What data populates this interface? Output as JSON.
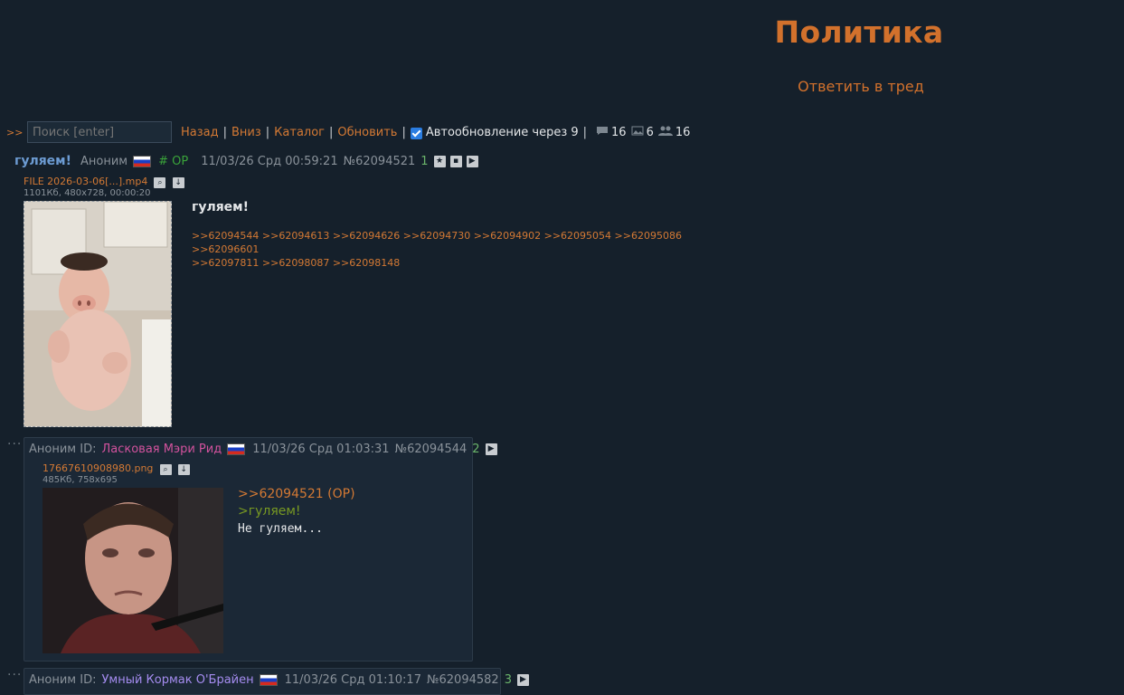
{
  "board": {
    "title": "Политика",
    "reply_link": "Ответить в тред"
  },
  "toolbar": {
    "marker": ">>",
    "search_placeholder": "Поиск [enter]",
    "back": "Назад",
    "down": "Вниз",
    "catalog": "Каталог",
    "refresh": "Обновить",
    "auto_update": "Автообновление через 9",
    "posts_count": "16",
    "images_count": "6",
    "posters_count": "16"
  },
  "op": {
    "subject": "гуляем!",
    "author": "Аноним",
    "op_tag": "# OP",
    "datetime": "11/03/26 Срд 00:59:21",
    "number": "№62094521",
    "index": "1",
    "file_name": "FILE 2026-03-06[...].mp4",
    "file_meta": "1101Кб, 480x728, 00:00:20",
    "body_title": "гуляем!",
    "replies": [
      ">>62094544",
      ">>62094613",
      ">>62094626",
      ">>62094730",
      ">>62094902",
      ">>62095054",
      ">>62095086",
      ">>62096601",
      ">>62097811",
      ">>62098087",
      ">>62098148"
    ]
  },
  "reply1": {
    "author": "Аноним ID:",
    "nickname": "Ласковая Мэри Рид",
    "datetime": "11/03/26 Срд 01:03:31",
    "number": "№62094544",
    "index": "2",
    "file_name": "17667610908980.png",
    "file_meta": "485Кб, 758x695",
    "quote_link": ">>62094521 (OP)",
    "greentext": ">гуляем!",
    "text": "Не гуляем..."
  },
  "reply2": {
    "author": "Аноним ID:",
    "nickname": "Умный Кормак О'Брайен",
    "datetime": "11/03/26 Срд 01:10:17",
    "number": "№62094582",
    "index": "3"
  },
  "colors": {
    "background": "#15202b",
    "accent": "#d2712c",
    "post_bg": "#1b2836",
    "greentext": "#789922"
  }
}
